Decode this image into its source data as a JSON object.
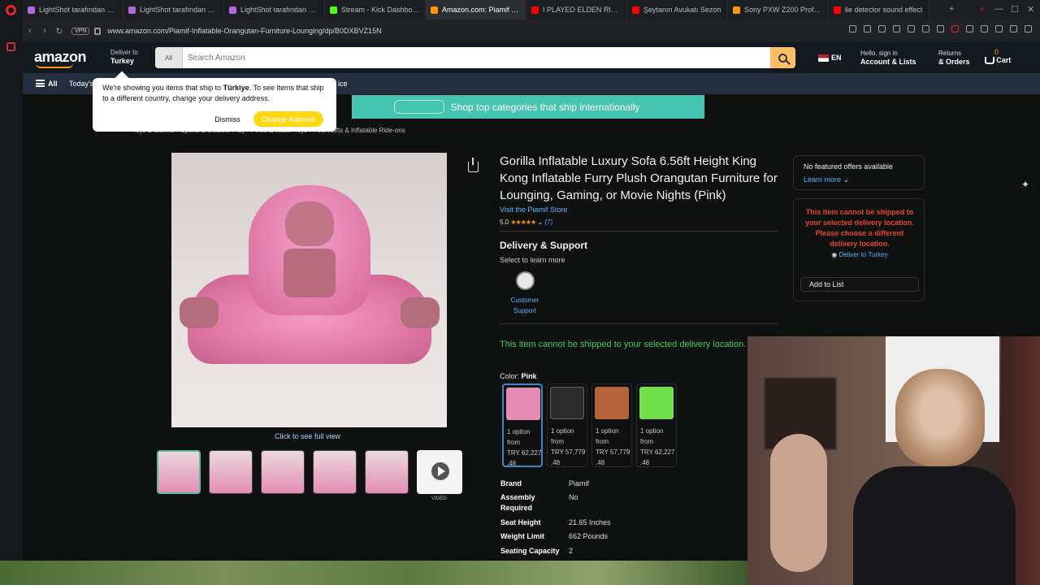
{
  "browser": {
    "tabs": [
      {
        "label": "LightShot tarafından Ekr",
        "color": "#b067e0"
      },
      {
        "label": "LightShot tarafından Ekr",
        "color": "#b067e0"
      },
      {
        "label": "LightShot tarafından Ekr",
        "color": "#b067e0"
      },
      {
        "label": "Stream - Kick Dashboard",
        "color": "#53fc18"
      },
      {
        "label": "Amazon.com: Piamif Gori",
        "color": "#ff9900"
      },
      {
        "label": "I PLAYED ELDEN RING O",
        "color": "#ff0000"
      },
      {
        "label": "Şeytanın Avukatı Sezon",
        "color": "#ff0000"
      },
      {
        "label": "Sony PXW Z200 Profesy",
        "color": "#ff9900"
      },
      {
        "label": "lie detector sound effect",
        "color": "#ff0000"
      }
    ],
    "active_tab_index": 4,
    "vpn_label": "VPN",
    "url": "www.amazon.com/Piamif-Inflatable-Orangutan-Furniture-Lounging/dp/B0DXBVZ15N"
  },
  "header": {
    "logo": "amazon",
    "deliver_line1": "Deliver to",
    "deliver_line2": "Turkey",
    "search_category": "All",
    "search_placeholder": "Search Amazon",
    "language": "EN",
    "account_line1": "Hello, sign in",
    "account_line2": "Account & Lists",
    "returns_line1": "Returns",
    "returns_line2": "& Orders",
    "cart_count": "0",
    "cart_label": "Cart"
  },
  "navbelt": {
    "all_label": "All",
    "todays": "Today's",
    "trailing": "ice"
  },
  "banner": {
    "text": "Shop top categories that ship internationally",
    "color": "#45c4b0"
  },
  "popover": {
    "text_pre": "We're showing you items that ship to ",
    "country": "Türkiye",
    "text_post": ". To see items that ship to a different country, change your delivery address.",
    "dismiss": "Dismiss",
    "change": "Change Address"
  },
  "breadcrumb": "Toys & Games › Sports & Outdoor Play › Pools & Water Toys › Pool Rafts & Inflatable Ride-ons",
  "product": {
    "title": "Gorilla Inflatable Luxury Sofa 6.56ft Height King Kong Inflatable Furry Plush Orangutan Furniture for Lounging, Gaming, or Movie Nights (Pink)",
    "store_link": "Visit the Piamif Store",
    "rating_value": "5.0",
    "stars": "★★★★★",
    "rating_count": "(7)",
    "see_full_view": "Click to see full view",
    "video_label": "VIDEO",
    "delivery_title": "Delivery & Support",
    "delivery_sub": "Select to learn more",
    "customer_support": "Customer Support",
    "ship_warning": "This item cannot be shipped to your selected delivery location. Please choose a different delivery location.",
    "color_label": "Color:",
    "color_value": "Pink",
    "swatches": [
      {
        "name": "pink",
        "color": "#e58db4",
        "line1": "1 option",
        "line2": "from",
        "price": "TRY 62,227",
        "cents": ".48"
      },
      {
        "name": "black",
        "color": "#2b2b2b",
        "line1": "1 option",
        "line2": "from",
        "price": "TRY 57,779",
        "cents": ".48"
      },
      {
        "name": "brown",
        "color": "#b3643a",
        "line1": "1 option",
        "line2": "from",
        "price": "TRY 57,779",
        "cents": ".48"
      },
      {
        "name": "green",
        "color": "#6fe04a",
        "line1": "1 option",
        "line2": "from",
        "price": "TRY 62,227",
        "cents": ".48"
      }
    ],
    "specs": [
      {
        "key": "Brand",
        "value": "Piamif"
      },
      {
        "key": "Assembly Required",
        "value": "No"
      },
      {
        "key": "Seat Height",
        "value": "21.65 Inches"
      },
      {
        "key": "Weight Limit",
        "value": "662 Pounds"
      },
      {
        "key": "Seating Capacity",
        "value": "2"
      }
    ]
  },
  "buybox": {
    "no_featured": "No featured offers available",
    "learn_more": "Learn more",
    "red_warning": "This item cannot be shipped to your selected delivery location. Please choose a different delivery location.",
    "deliver_to": "Deliver to Turkey",
    "add_to_list": "Add to List"
  }
}
